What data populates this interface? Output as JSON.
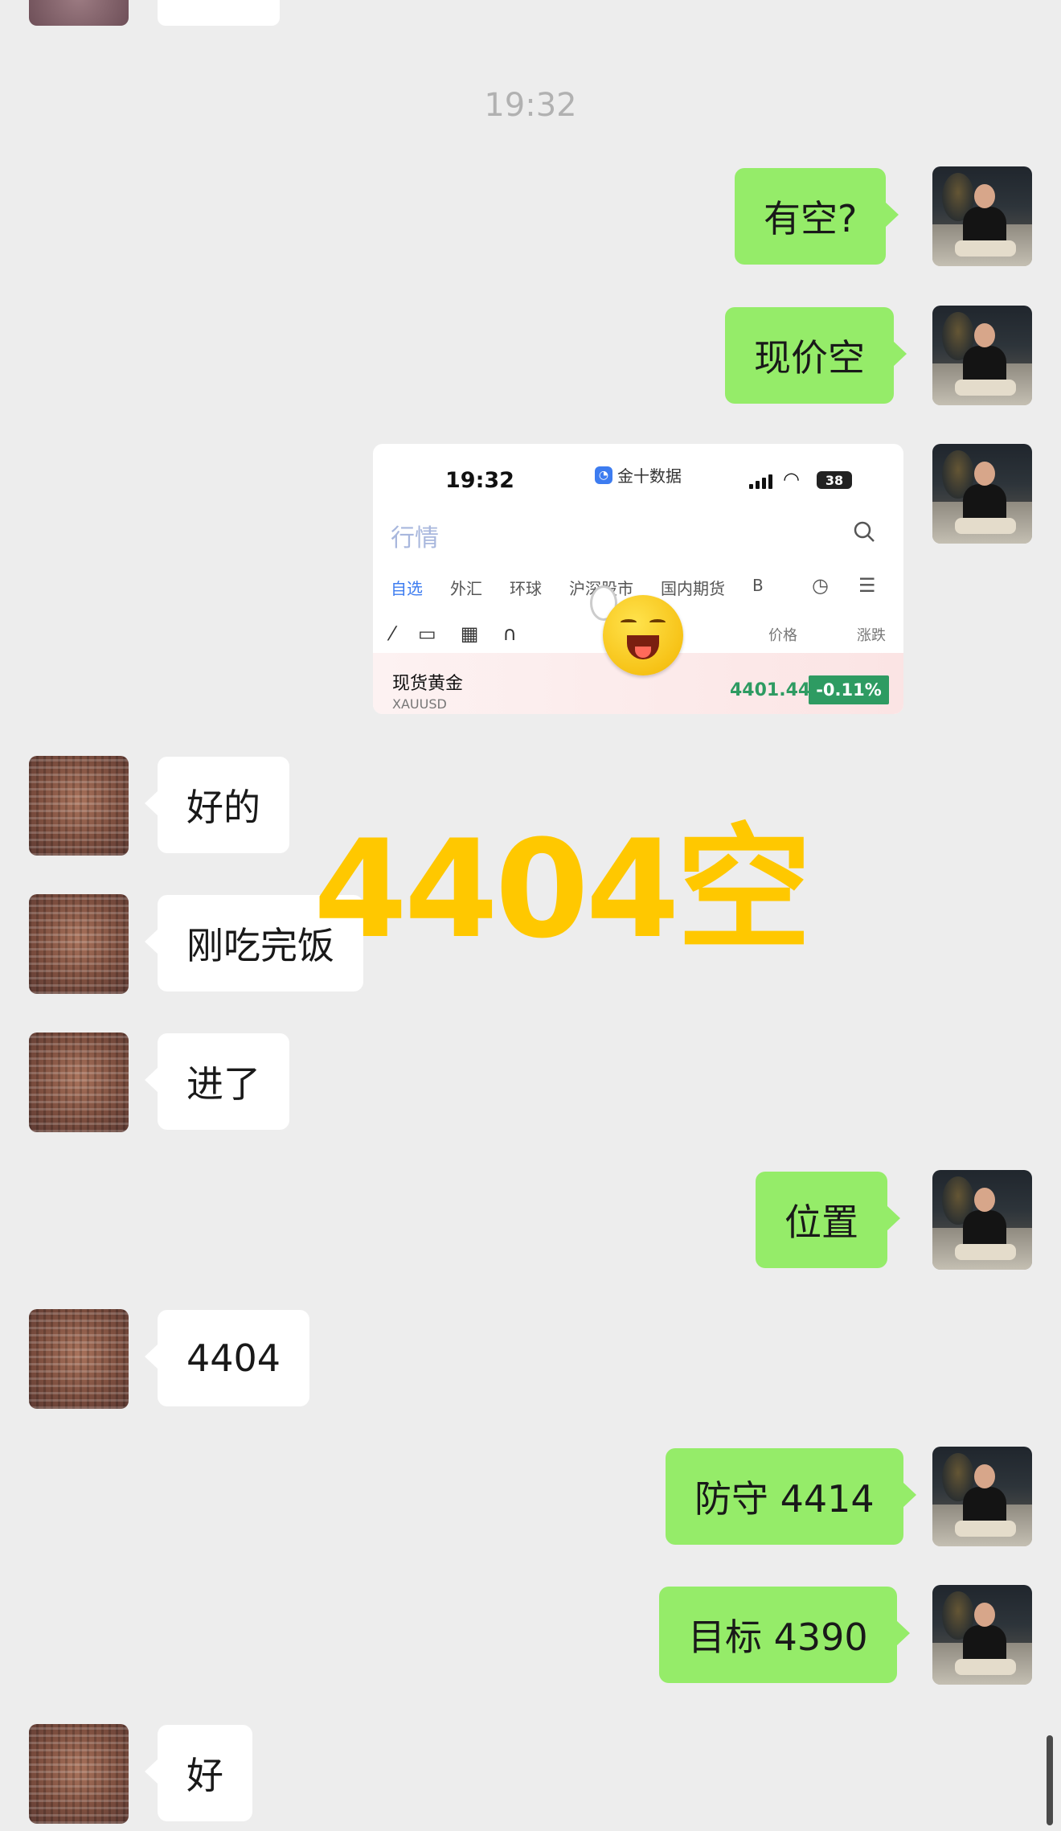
{
  "chat": {
    "timestamp": "19:32",
    "messages": [
      {
        "from": "me",
        "text": "有空?"
      },
      {
        "from": "me",
        "text": "现价空"
      },
      {
        "from": "me",
        "type": "image"
      },
      {
        "from": "them",
        "text": "好的"
      },
      {
        "from": "them",
        "text": "刚吃完饭"
      },
      {
        "from": "them",
        "text": "进了"
      },
      {
        "from": "me",
        "text": "位置"
      },
      {
        "from": "them",
        "text": "4404"
      },
      {
        "from": "me",
        "text": "防守 4414"
      },
      {
        "from": "me",
        "text": "目标 4390"
      },
      {
        "from": "them",
        "text": "好"
      }
    ]
  },
  "overlay": {
    "text": "4404空",
    "color": "#ffc800"
  },
  "screenshot": {
    "status_time": "19:32",
    "app_name": "金十数据",
    "battery": "38",
    "title": "行情",
    "tabs": [
      "自选",
      "外汇",
      "环球",
      "沪深股市",
      "国内期货",
      "B"
    ],
    "col_price": "价格",
    "col_change": "涨跌",
    "row": {
      "name": "现货黄金",
      "code": "XAUUSD",
      "price": "4401.44",
      "change": "-0.11%"
    }
  },
  "colors": {
    "background": "#ededed",
    "my_bubble": "#95ec69",
    "their_bubble": "#ffffff",
    "timestamp": "#b1b1b1",
    "down_green": "#2e9b62"
  }
}
